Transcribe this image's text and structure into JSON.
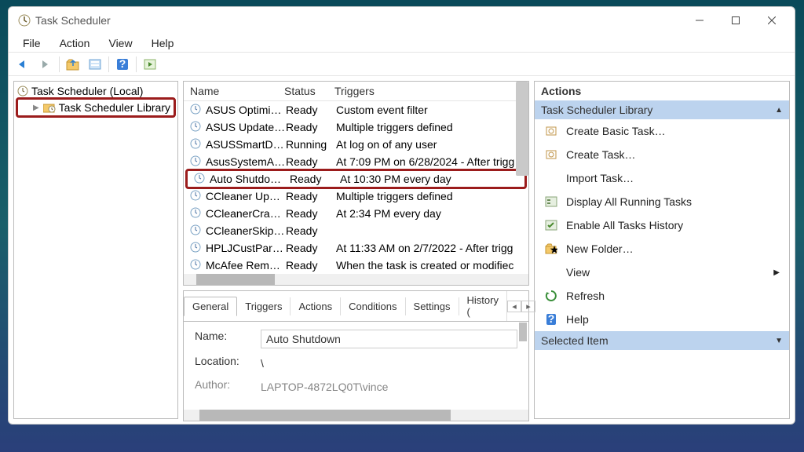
{
  "window": {
    "title": "Task Scheduler"
  },
  "menu": {
    "file": "File",
    "action": "Action",
    "view": "View",
    "help": "Help"
  },
  "tree": {
    "root": "Task Scheduler (Local)",
    "library": "Task Scheduler Library"
  },
  "list": {
    "headers": {
      "name": "Name",
      "status": "Status",
      "triggers": "Triggers"
    },
    "rows": [
      {
        "name": "ASUS Optimi…",
        "status": "Ready",
        "trigger": "Custom event filter"
      },
      {
        "name": "ASUS Update…",
        "status": "Ready",
        "trigger": "Multiple triggers defined"
      },
      {
        "name": "ASUSSmartDi…",
        "status": "Running",
        "trigger": "At log on of any user"
      },
      {
        "name": "AsusSystemA…",
        "status": "Ready",
        "trigger": "At 7:09 PM on 6/28/2024 - After trigg"
      },
      {
        "name": "Auto Shutdo…",
        "status": "Ready",
        "trigger": "At 10:30 PM every day",
        "hl": true
      },
      {
        "name": "CCleaner Up…",
        "status": "Ready",
        "trigger": "Multiple triggers defined"
      },
      {
        "name": "CCleanerCras…",
        "status": "Ready",
        "trigger": "At 2:34 PM every day"
      },
      {
        "name": "CCleanerSkip…",
        "status": "Ready",
        "trigger": ""
      },
      {
        "name": "HPLJCustPart…",
        "status": "Ready",
        "trigger": "At 11:33 AM on 2/7/2022 - After trigg"
      },
      {
        "name": "McAfee Rem…",
        "status": "Ready",
        "trigger": "When the task is created or modifiec"
      }
    ]
  },
  "details": {
    "tabs": {
      "general": "General",
      "triggers": "Triggers",
      "actions": "Actions",
      "conditions": "Conditions",
      "settings": "Settings",
      "history": "History ("
    },
    "name_label": "Name:",
    "name_value": "Auto Shutdown",
    "location_label": "Location:",
    "location_value": "\\",
    "author_label": "Author:",
    "author_value": "LAPTOP-4872LQ0T\\vince"
  },
  "actions": {
    "heading": "Actions",
    "section1": "Task Scheduler Library",
    "items": [
      "Create Basic Task…",
      "Create Task…",
      "Import Task…",
      "Display All Running Tasks",
      "Enable All Tasks History",
      "New Folder…",
      "View",
      "Refresh",
      "Help"
    ],
    "section2": "Selected Item"
  }
}
